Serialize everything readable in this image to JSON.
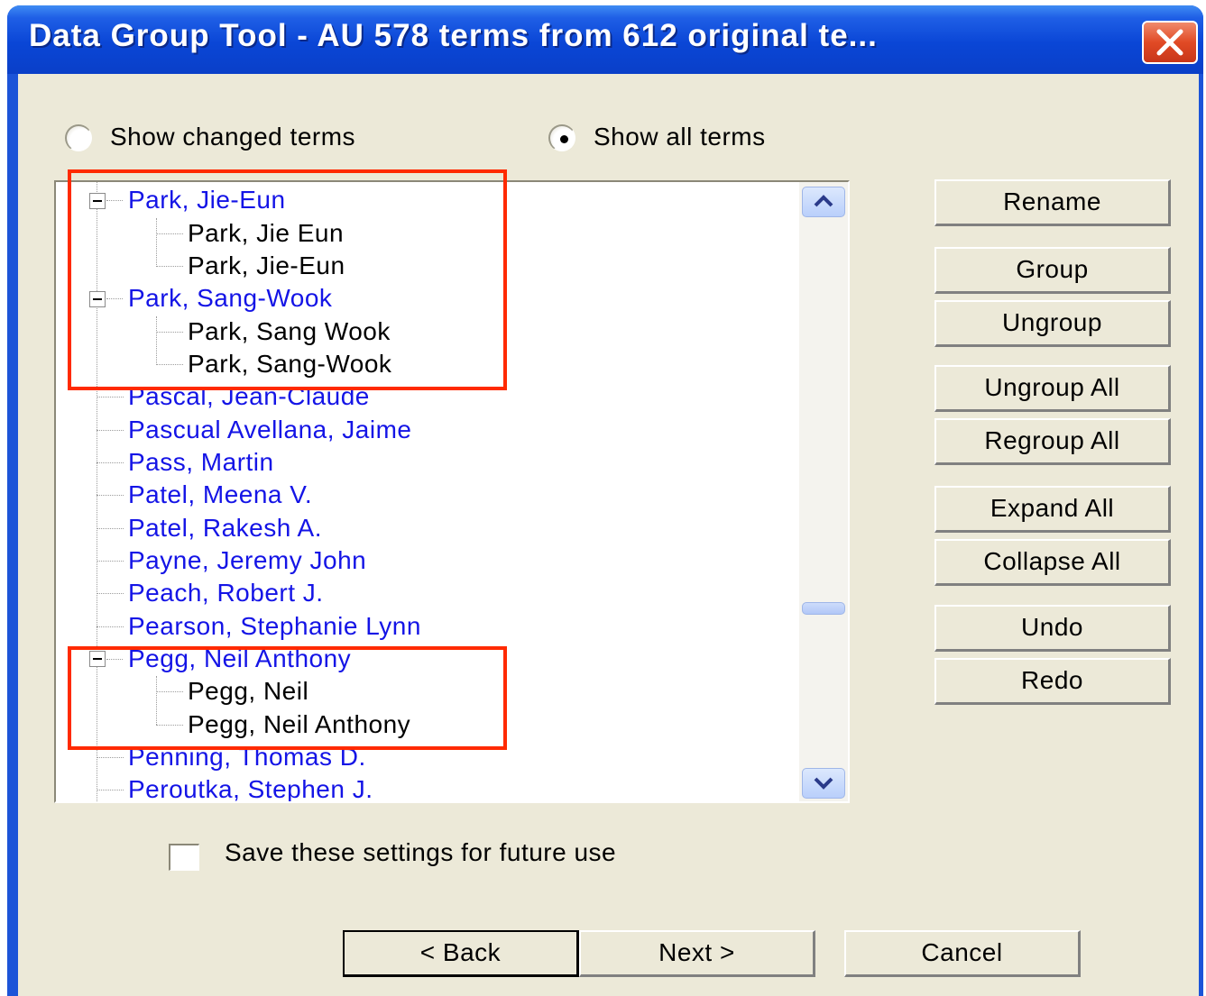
{
  "window": {
    "title": "Data Group Tool - AU  578 terms from 612 original te...",
    "close_icon": "close-icon"
  },
  "view_options": {
    "show_changed_label": "Show changed terms",
    "show_all_label": "Show all terms",
    "selected": "Show all terms"
  },
  "tree": {
    "rows": [
      {
        "label": "Park, Jie-Eun"
      },
      {
        "label": "Park, Jie Eun"
      },
      {
        "label": "Park, Jie-Eun"
      },
      {
        "label": "Park, Sang-Wook"
      },
      {
        "label": "Park, Sang Wook"
      },
      {
        "label": "Park, Sang-Wook"
      },
      {
        "label": "Pascal, Jean-Claude"
      },
      {
        "label": "Pascual Avellana, Jaime"
      },
      {
        "label": "Pass, Martin"
      },
      {
        "label": "Patel, Meena V."
      },
      {
        "label": "Patel, Rakesh A."
      },
      {
        "label": "Payne, Jeremy John"
      },
      {
        "label": "Peach, Robert J."
      },
      {
        "label": "Pearson, Stephanie Lynn"
      },
      {
        "label": "Pegg, Neil Anthony"
      },
      {
        "label": "Pegg, Neil"
      },
      {
        "label": "Pegg, Neil Anthony"
      },
      {
        "label": "Penning, Thomas D."
      },
      {
        "label": "Peroutka, Stephen J."
      }
    ],
    "highlight_color": "#ff2a00",
    "term_color": "#1414e6"
  },
  "actions": {
    "rename": "Rename",
    "group": "Group",
    "ungroup": "Ungroup",
    "ungroup_all": "Ungroup All",
    "regroup_all": "Regroup All",
    "expand_all": "Expand All",
    "collapse_all": "Collapse All",
    "undo": "Undo",
    "redo": "Redo"
  },
  "save_settings": {
    "label": "Save these settings for future use",
    "checked": false
  },
  "nav": {
    "back": "< Back",
    "next": "Next >",
    "cancel": "Cancel"
  }
}
